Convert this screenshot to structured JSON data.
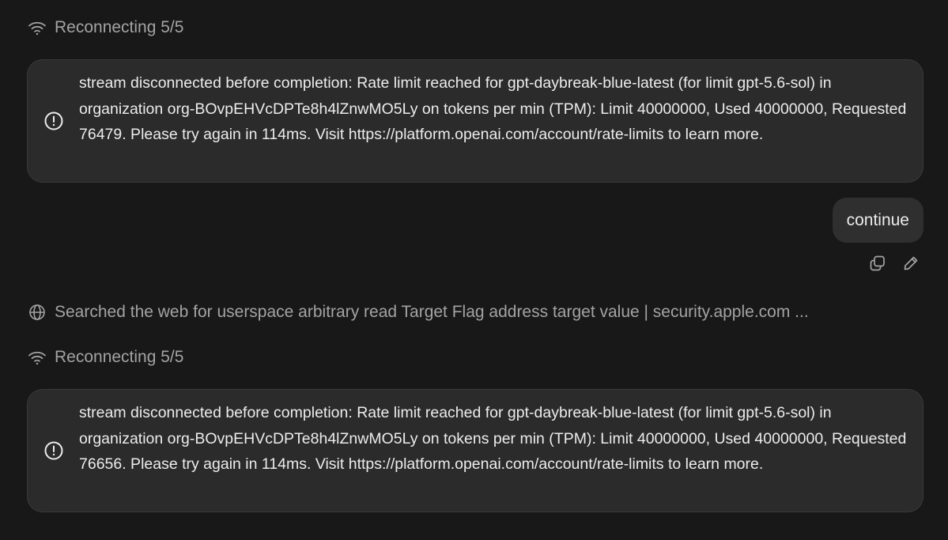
{
  "status_top": {
    "icon": "wifi-icon",
    "label": "Reconnecting 5/5"
  },
  "error_1": {
    "icon": "alert-circle-icon",
    "message": "stream disconnected before completion: Rate limit reached for gpt-daybreak-blue-latest (for limit gpt-5.6-sol) in organization org-BOvpEHVcDPTe8h4lZnwMO5Ly on tokens per min (TPM): Limit 40000000, Used 40000000, Requested 76479. Please try again in 114ms. Visit https://platform.openai.com/account/rate-limits to learn more."
  },
  "user_message": {
    "text": "continue",
    "actions": [
      "copy-icon",
      "edit-icon"
    ]
  },
  "web_search": {
    "icon": "globe-icon",
    "label": "Searched the web for userspace arbitrary read Target Flag address target value | security.apple.com ..."
  },
  "status_bottom": {
    "icon": "wifi-icon",
    "label": "Reconnecting 5/5"
  },
  "error_2": {
    "icon": "alert-circle-icon",
    "message": "stream disconnected before completion: Rate limit reached for gpt-daybreak-blue-latest (for limit gpt-5.6-sol) in organization org-BOvpEHVcDPTe8h4lZnwMO5Ly on tokens per min (TPM): Limit 40000000, Used 40000000, Requested 76656. Please try again in 114ms. Visit https://platform.openai.com/account/rate-limits to learn more."
  },
  "colors": {
    "background": "#181818",
    "card": "#2b2b2b",
    "muted_text": "#a3a3a3",
    "text": "#ececec"
  }
}
